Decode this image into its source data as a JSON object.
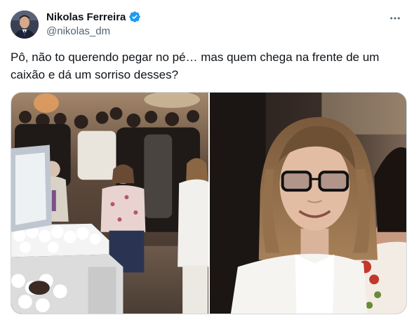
{
  "author": {
    "display_name": "Nikolas Ferreira",
    "handle": "@nikolas_dm",
    "verified": true,
    "verified_color": "#1d9bf0",
    "avatar_icon": "profile-photo"
  },
  "menu_icon": "more-horizontal-icon",
  "tweet": {
    "text": "Pô, não to querendo pegar no pé… mas quem chega na frente de um caixão e dá um sorriso desses?"
  },
  "media": {
    "photos": [
      {
        "name": "funeral-scene-photo"
      },
      {
        "name": "smiling-woman-closeup-photo"
      }
    ]
  },
  "colors": {
    "text_primary": "#0f1419",
    "text_secondary": "#536471",
    "border": "#cfd9de"
  }
}
